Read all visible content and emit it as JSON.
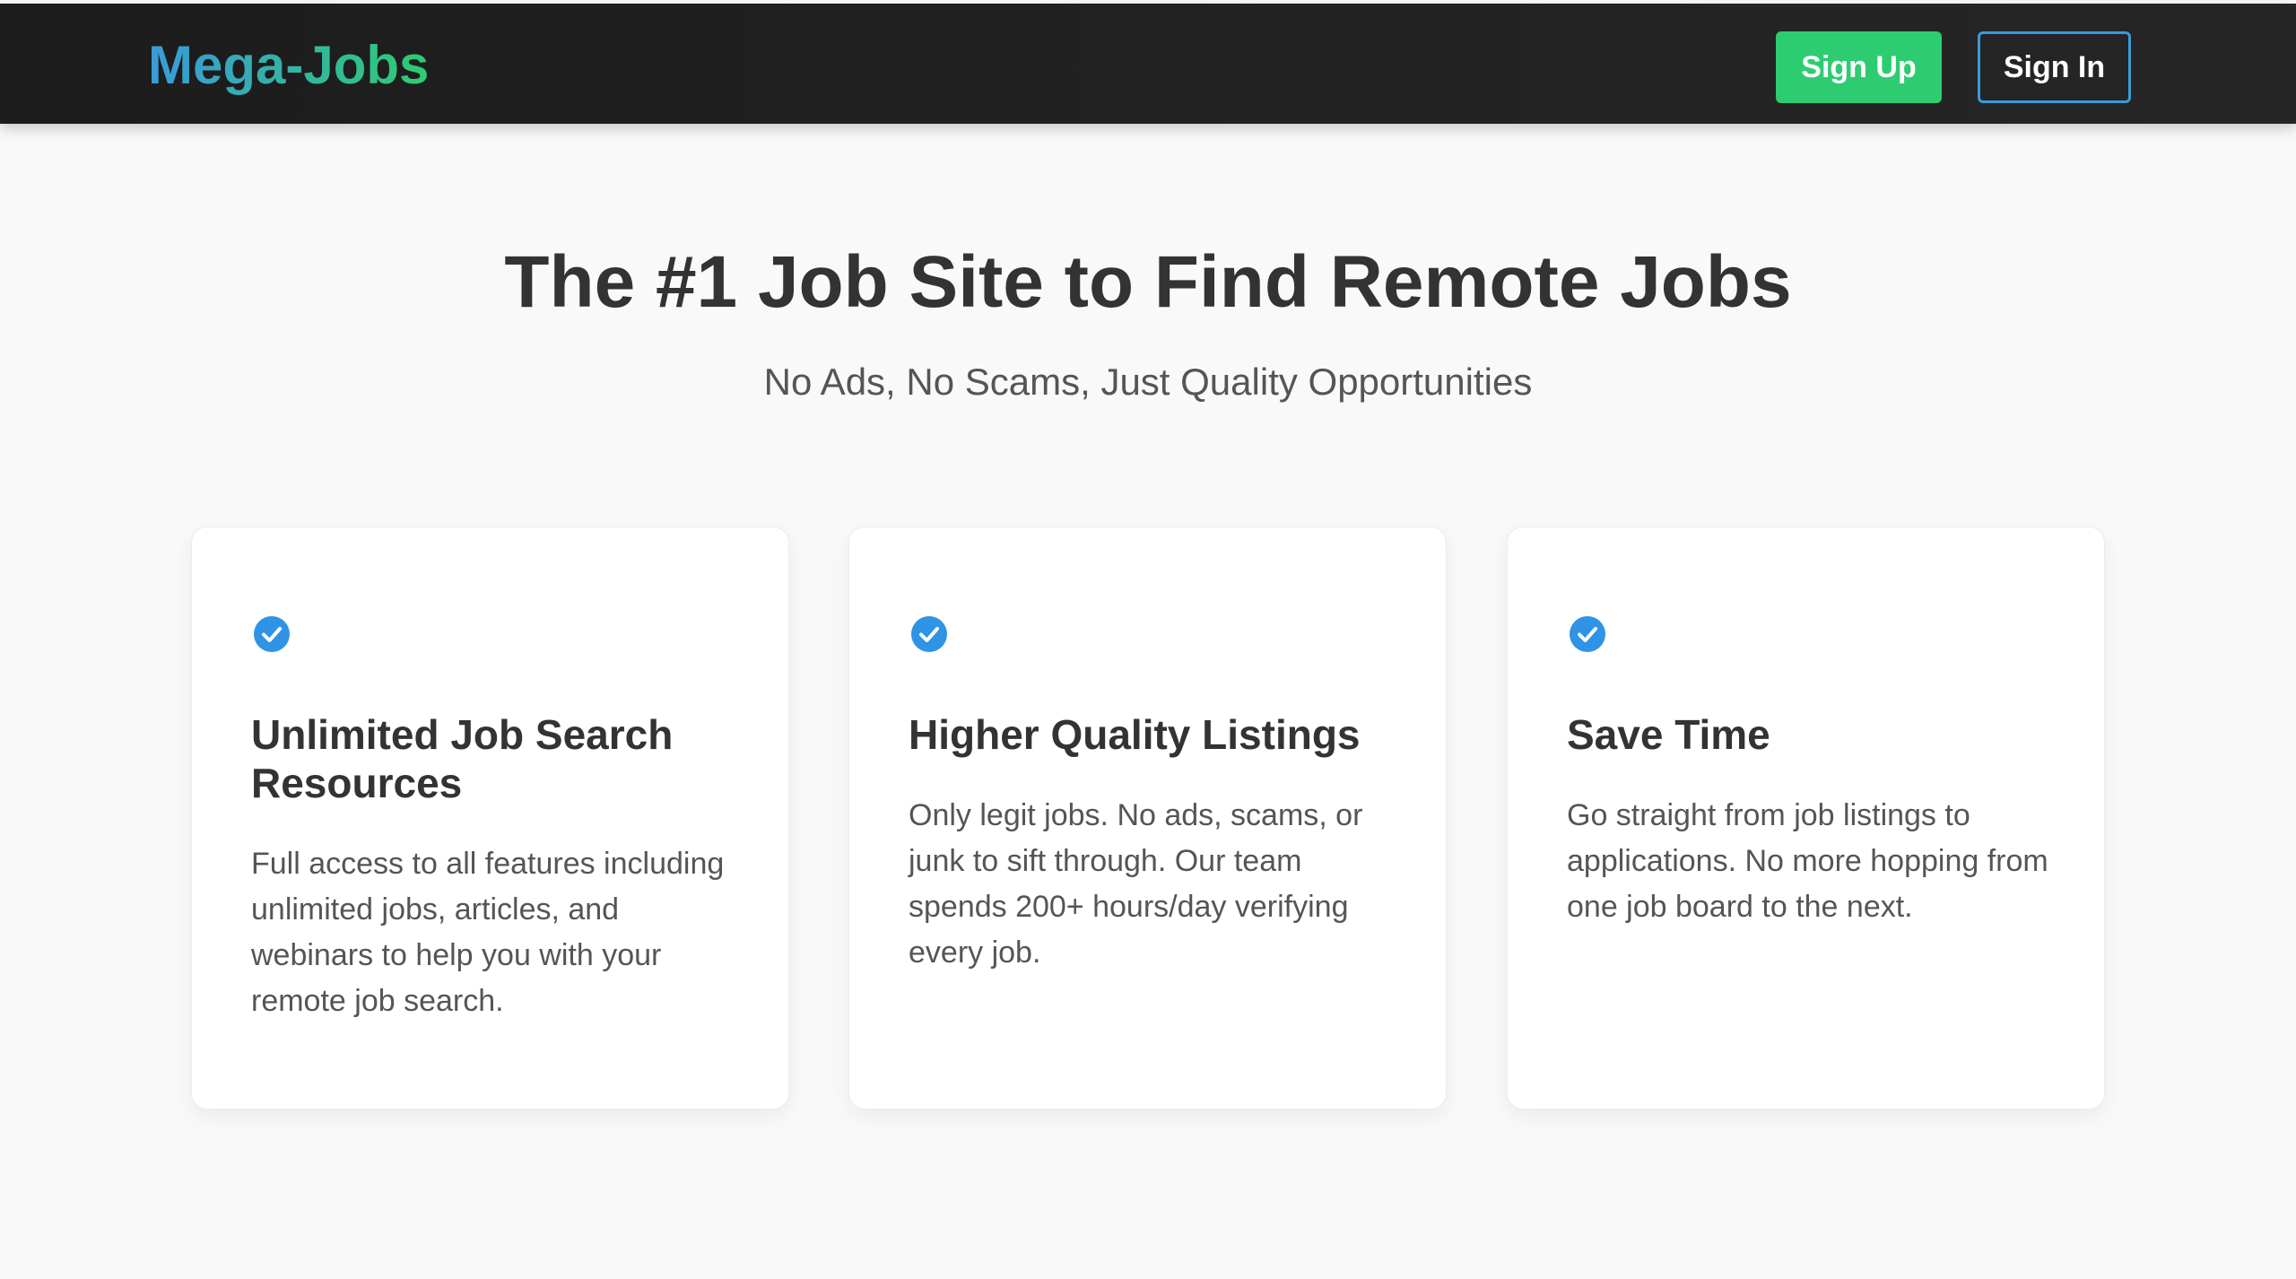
{
  "header": {
    "logo": "Mega-Jobs",
    "signup_label": "Sign Up",
    "signin_label": "Sign In"
  },
  "hero": {
    "title": "The #1 Job Site to Find Remote Jobs",
    "subtitle": "No Ads, No Scams, Just Quality Opportunities"
  },
  "features": [
    {
      "icon": "check-circle-icon",
      "title": "Unlimited Job Search Resources",
      "text": "Full access to all features including unlimited jobs, articles, and webinars to help you with your remote job search."
    },
    {
      "icon": "check-circle-icon",
      "title": "Higher Quality Listings",
      "text": "Only legit jobs. No ads, scams, or junk to sift through. Our team spends 200+ hours/day verifying every job."
    },
    {
      "icon": "check-circle-icon",
      "title": "Save Time",
      "text": "Go straight from job listings to applications. No more hopping from one job board to the next."
    }
  ],
  "colors": {
    "accent_blue": "#3a9ad9",
    "accent_green": "#2ecc71",
    "header_bg": "#1c1c1c",
    "page_bg": "#f9f9f9"
  }
}
